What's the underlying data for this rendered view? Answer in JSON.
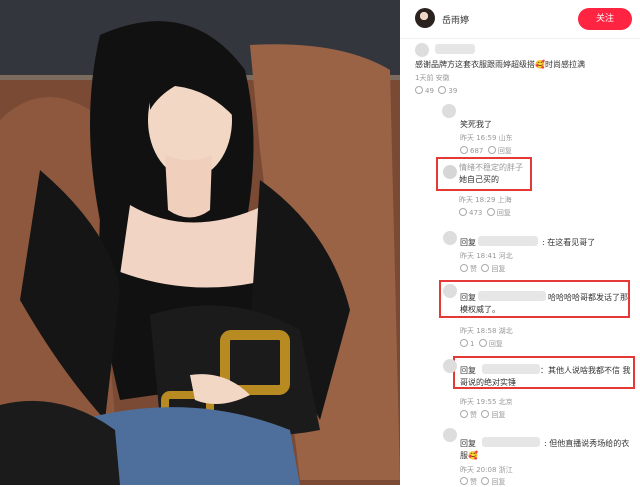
{
  "post": {
    "author": "岳雨婷",
    "follow_label": "关注"
  },
  "comments": [
    {
      "text": "感谢品牌方这套衣服跟雨婷超级搭🥰时尚感拉满",
      "meta": "1天前 安徽",
      "likes": "49",
      "replies": "39"
    },
    {
      "text": "笑死我了",
      "meta": "昨天 16:59 山东",
      "likes": "687",
      "replies": "回复"
    },
    {
      "user": "情绪不稳定的胖子",
      "text": "她自己买的",
      "meta": "昨天 18:29 上海",
      "likes": "473",
      "replies": "回复"
    },
    {
      "prefix": "回复",
      "suffix": ": 在这看见哥了",
      "meta": "昨天 18:41 河北",
      "likes": "赞",
      "replies": "回复"
    },
    {
      "prefix": "回复",
      "text": "哈哈哈哈哥都发话了那",
      "text2": "模权威了。",
      "meta": "昨天 18:58 湖北",
      "likes": "1",
      "replies": "回复"
    },
    {
      "prefix": "回复",
      "text": "：其他人说啥我都不信 我",
      "text2": "哥说的绝对实锤",
      "meta": "昨天 19:55 北京",
      "likes": "赞",
      "replies": "回复"
    },
    {
      "prefix": "回复",
      "text": ": 但他直播说秀场给的衣",
      "text2": "服🥰",
      "meta": "昨天 20:08 浙江",
      "likes": "赞",
      "replies": "回复"
    }
  ],
  "colors": {
    "accent": "#ff2442",
    "highlight": "#e53935"
  }
}
